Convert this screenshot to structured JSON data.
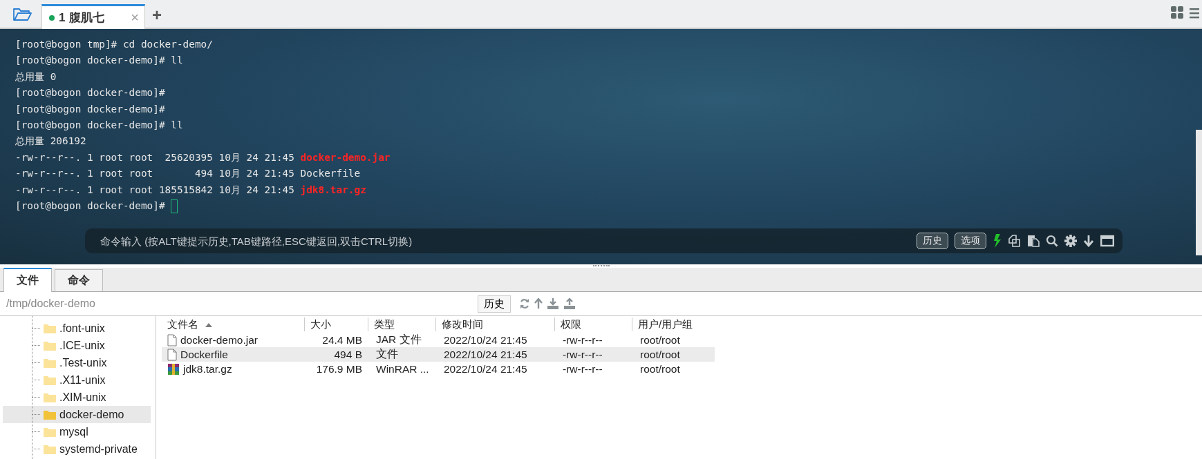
{
  "session_tabs": [
    {
      "number": "1",
      "label": "腹肌七",
      "connected": true,
      "close": "×",
      "selected": true
    }
  ],
  "add_tab": "+",
  "terminal": {
    "lines": [
      [
        {
          "kind": "plain",
          "text": "[root@bogon tmp]# cd docker-demo/"
        }
      ],
      [
        {
          "kind": "plain",
          "text": "[root@bogon docker-demo]# ll"
        }
      ],
      [
        {
          "kind": "plain",
          "text": "总用量 0"
        }
      ],
      [
        {
          "kind": "plain",
          "text": "[root@bogon docker-demo]#"
        }
      ],
      [
        {
          "kind": "plain",
          "text": "[root@bogon docker-demo]#"
        }
      ],
      [
        {
          "kind": "plain",
          "text": "[root@bogon docker-demo]# ll"
        }
      ],
      [
        {
          "kind": "plain",
          "text": "总用量 206192"
        }
      ],
      [
        {
          "kind": "plain",
          "text": "-rw-r--r--. 1 root root  25620395 10月 24 21:45 "
        },
        {
          "kind": "archive",
          "text": "docker-demo.jar"
        }
      ],
      [
        {
          "kind": "plain",
          "text": "-rw-r--r--. 1 root root       494 10月 24 21:45 Dockerfile"
        }
      ],
      [
        {
          "kind": "plain",
          "text": "-rw-r--r--. 1 root root 185515842 10月 24 21:45 "
        },
        {
          "kind": "archive",
          "text": "jdk8.tar.gz"
        }
      ],
      [
        {
          "kind": "prompt",
          "text": "[root@bogon docker-demo]# "
        }
      ]
    ]
  },
  "command_bar": {
    "placeholder": "命令输入 (按ALT键提示历史,TAB键路径,ESC键返回,双击CTRL切换)",
    "buttons": [
      "历史",
      "选项"
    ]
  },
  "panel_tabs": [
    {
      "label": "文件",
      "selected": true
    },
    {
      "label": "命令",
      "selected": false
    }
  ],
  "path": {
    "value": "/tmp/docker-demo",
    "history_button": "历史"
  },
  "tree": {
    "items": [
      {
        "label": ".font-unix",
        "selected": false
      },
      {
        "label": ".ICE-unix",
        "selected": false
      },
      {
        "label": ".Test-unix",
        "selected": false
      },
      {
        "label": ".X11-unix",
        "selected": false
      },
      {
        "label": ".XIM-unix",
        "selected": false
      },
      {
        "label": "docker-demo",
        "selected": true
      },
      {
        "label": "mysql",
        "selected": false
      },
      {
        "label": "systemd-private",
        "selected": false
      }
    ]
  },
  "table": {
    "columns": [
      "文件名",
      "大小",
      "类型",
      "修改时间",
      "权限",
      "用户/用户组"
    ],
    "rows": [
      {
        "kind": "file",
        "selected": false,
        "cells": [
          "docker-demo.jar",
          "24.4 MB",
          "JAR 文件",
          "2022/10/24 21:45",
          "-rw-r--r--",
          "root/root"
        ]
      },
      {
        "kind": "file",
        "selected": true,
        "cells": [
          "Dockerfile",
          "494 B",
          "文件",
          "2022/10/24 21:45",
          "-rw-r--r--",
          "root/root"
        ]
      },
      {
        "kind": "archive",
        "selected": false,
        "cells": [
          "jdk8.tar.gz",
          "176.9 MB",
          "WinRAR ...",
          "2022/10/24 21:45",
          "-rw-r--r--",
          "root/root"
        ]
      }
    ]
  }
}
